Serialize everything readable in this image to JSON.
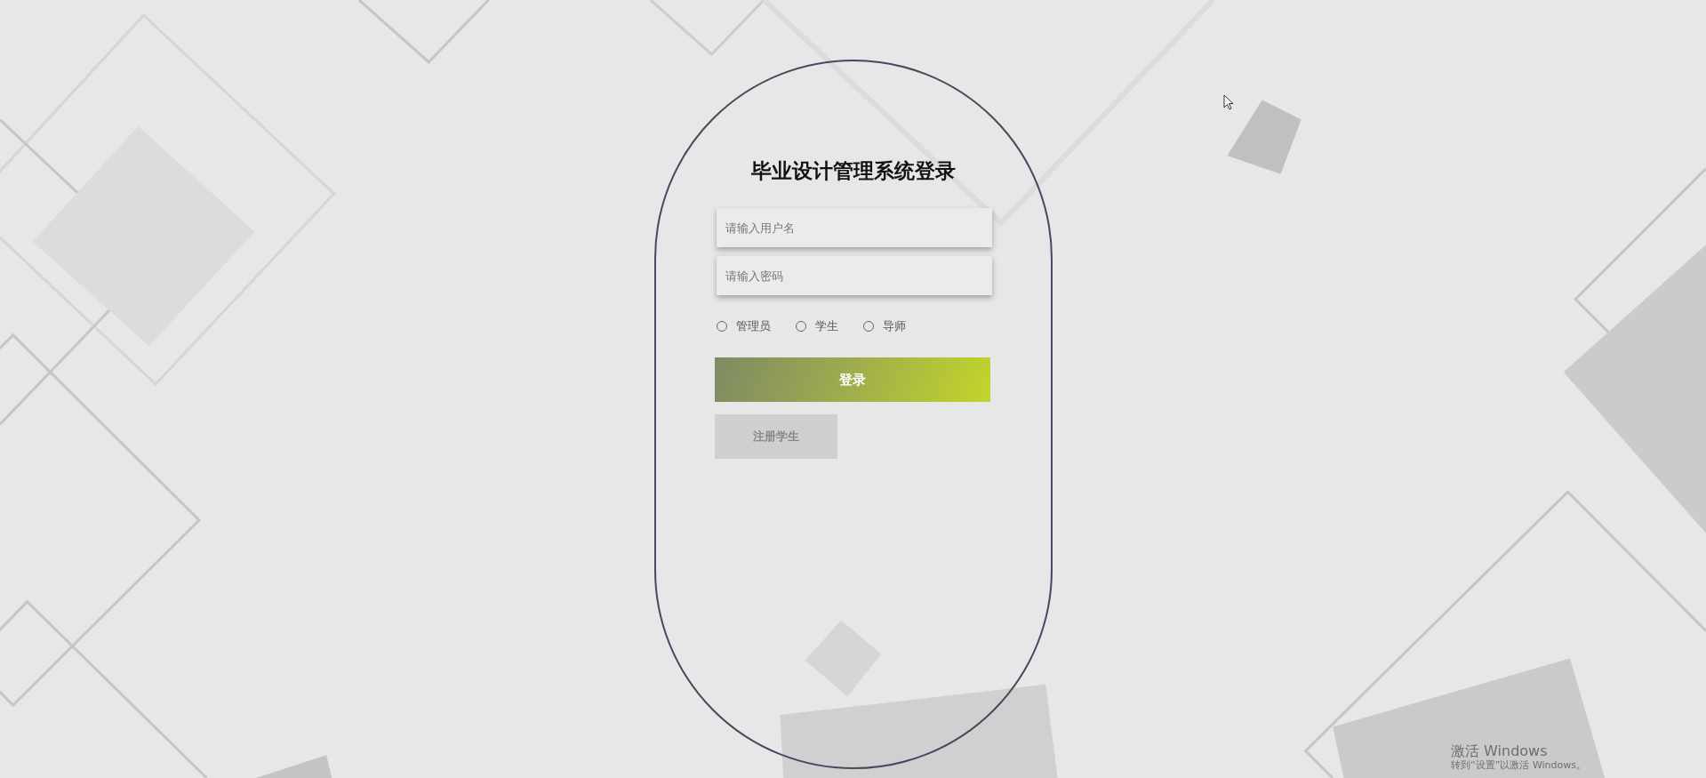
{
  "login": {
    "title": "毕业设计管理系统登录",
    "fields": [
      {
        "placeholder": "请输入用户名"
      },
      {
        "placeholder": "请输入密码"
      }
    ],
    "roles": [
      {
        "label": "管理员",
        "selected": false
      },
      {
        "label": "学生",
        "selected": false
      },
      {
        "label": "导师",
        "selected": false
      }
    ],
    "login_button": "登录",
    "register_button": "注册学生"
  },
  "activation_notice": {
    "title": "激活 Windows",
    "text": "转到“设置”以激活 Windows。"
  }
}
